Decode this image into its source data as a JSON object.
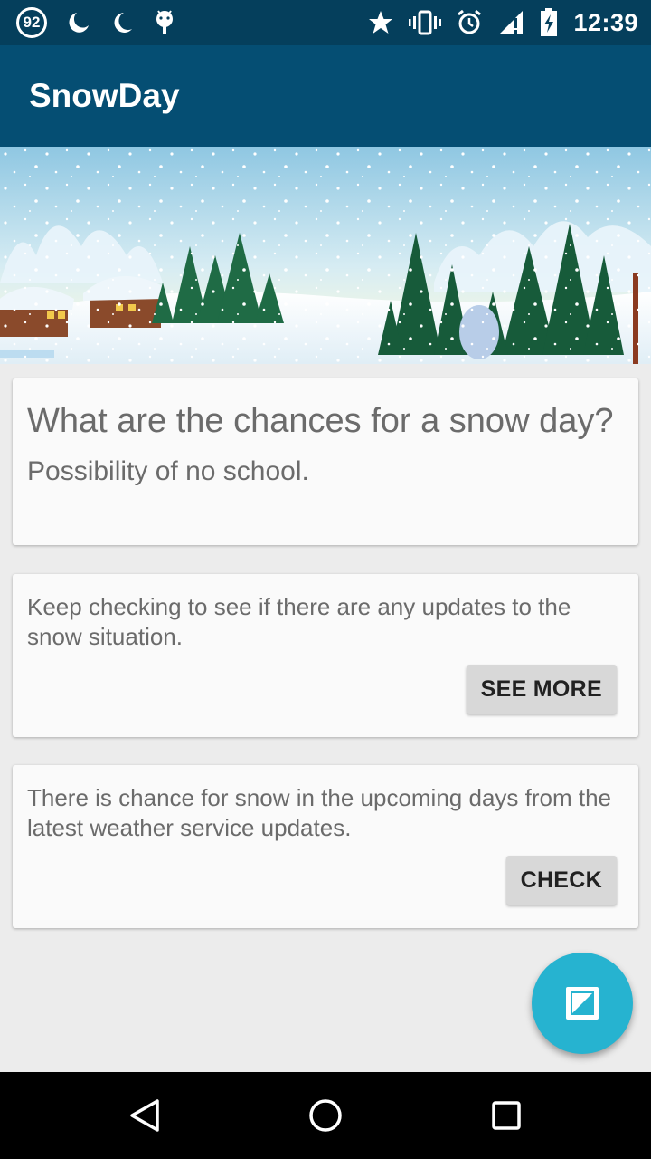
{
  "status_bar": {
    "notification_count": "92",
    "time": "12:39",
    "icons": [
      "moon-icon",
      "moon-icon",
      "android-icon",
      "star-icon",
      "vibrate-icon",
      "alarm-icon",
      "signal-icon",
      "battery-charging-icon"
    ]
  },
  "app_bar": {
    "title": "SnowDay"
  },
  "card_intro": {
    "headline": "What are the chances for a snow day?",
    "subtitle": "Possibility of no school."
  },
  "card_updates": {
    "text": "Keep checking to see if there are any updates to the snow situation.",
    "button_label": "SEE MORE"
  },
  "card_forecast": {
    "text": "There is chance for snow in the upcoming days from the latest weather service updates.",
    "button_label": "CHECK"
  },
  "fab": {
    "icon": "image-icon",
    "color": "#26b3d0"
  },
  "nav": {
    "back_icon": "back-triangle-icon",
    "home_icon": "home-circle-icon",
    "recents_icon": "recents-square-icon"
  },
  "colors": {
    "status_bar": "#053f5c",
    "app_bar": "#054e73",
    "background": "#ececec",
    "card": "#fafafa"
  }
}
